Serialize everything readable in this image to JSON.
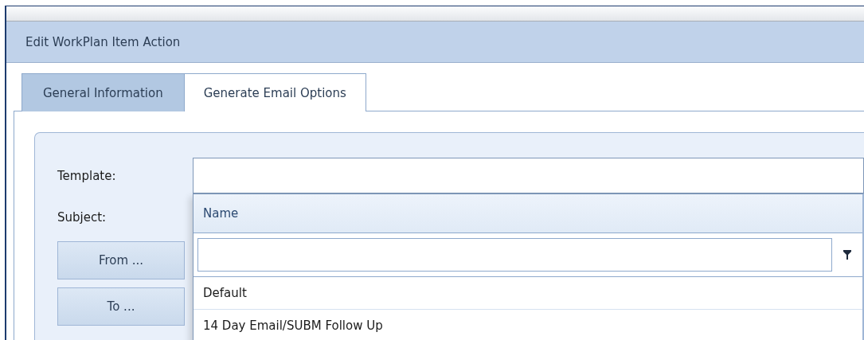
{
  "window": {
    "title": "Edit WorkPlan Item Action"
  },
  "tabs": [
    {
      "label": "General Information",
      "selected": false
    },
    {
      "label": "Generate Email Options",
      "selected": true
    }
  ],
  "form": {
    "template_label": "Template:",
    "subject_label": "Subject:",
    "buttons": [
      "From ...",
      "To ..."
    ]
  },
  "dropdown": {
    "column": "Name",
    "rows": [
      {
        "name": "Default"
      },
      {
        "name": "14 Day Email/SUBM Follow Up"
      }
    ]
  }
}
